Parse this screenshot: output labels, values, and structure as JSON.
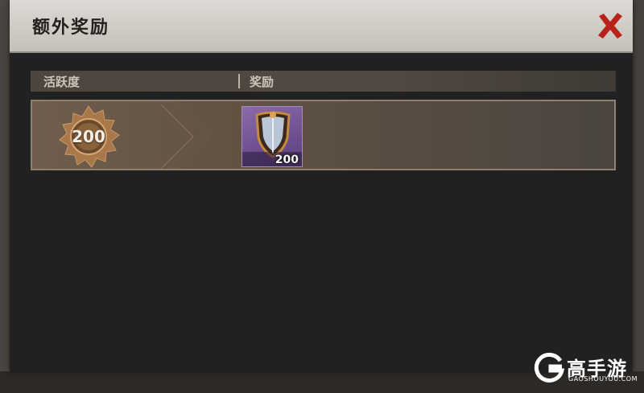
{
  "dialog": {
    "title": "额外奖励",
    "close_icon": "close-x-icon"
  },
  "table": {
    "columns": [
      "活跃度",
      "奖励"
    ],
    "rows": [
      {
        "activity": "200",
        "activity_icon": "gear-badge-icon",
        "rewards": [
          {
            "icon": "shield-icon",
            "quantity": "200"
          }
        ]
      }
    ]
  },
  "watermark": {
    "brand": "高手游",
    "url": "GAOSHOUYOU.COM",
    "logo_icon": "gaoshouyou-logo-icon"
  },
  "colors": {
    "close_red": "#b8221b",
    "row_gold": "#8f7f6e",
    "item_purple": "#6d4f8f"
  }
}
